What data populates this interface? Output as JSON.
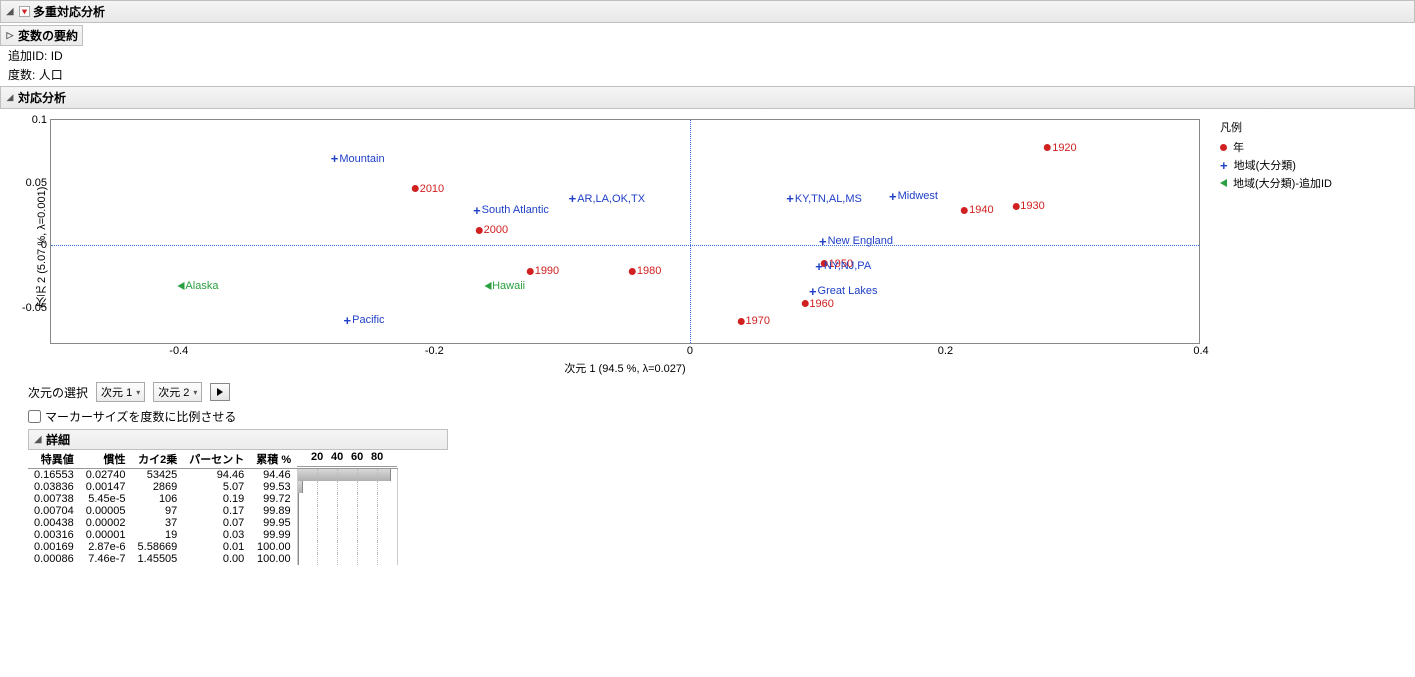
{
  "header": {
    "title": "多重対応分析"
  },
  "sub1": {
    "title": "変数の要約"
  },
  "info": {
    "id_label": "追加ID:",
    "id_value": "ID",
    "freq_label": "度数:",
    "freq_value": "人口"
  },
  "sub2": {
    "title": "対応分析"
  },
  "controls": {
    "dim_select_label": "次元の選択",
    "dim1": "次元 1",
    "dim2": "次元 2",
    "checkbox_label": "マーカーサイズを度数に比例させる"
  },
  "details_header": "詳細",
  "legend": {
    "title": "凡例",
    "item1": "年",
    "item2": "地域(大分類)",
    "item3": "地域(大分類)-追加ID"
  },
  "chart_data": {
    "type": "scatter",
    "xlabel": "次元 1  (94.5 %, λ=0.027)",
    "ylabel": "次元 2  (5.07 %, λ=0.001)",
    "xlim": [
      -0.5,
      0.4
    ],
    "ylim": [
      -0.08,
      0.1
    ],
    "xticks": [
      -0.4,
      -0.2,
      0,
      0.2,
      0.4
    ],
    "yticks": [
      -0.05,
      0,
      0.05,
      0.1
    ],
    "series": [
      {
        "name": "年",
        "marker": "dot",
        "color": "red",
        "points": [
          {
            "label": "2010",
            "x": -0.205,
            "y": 0.045
          },
          {
            "label": "2000",
            "x": -0.155,
            "y": 0.012
          },
          {
            "label": "1990",
            "x": -0.115,
            "y": -0.021
          },
          {
            "label": "1980",
            "x": -0.035,
            "y": -0.021
          },
          {
            "label": "1970",
            "x": 0.05,
            "y": -0.061
          },
          {
            "label": "1960",
            "x": 0.1,
            "y": -0.047
          },
          {
            "label": "1950",
            "x": 0.115,
            "y": -0.015
          },
          {
            "label": "1940",
            "x": 0.225,
            "y": 0.028
          },
          {
            "label": "1930",
            "x": 0.265,
            "y": 0.031
          },
          {
            "label": "1920",
            "x": 0.29,
            "y": 0.078
          }
        ]
      },
      {
        "name": "地域(大分類)",
        "marker": "plus",
        "color": "blue",
        "points": [
          {
            "label": "Mountain",
            "x": -0.26,
            "y": 0.069
          },
          {
            "label": "Pacific",
            "x": -0.255,
            "y": -0.06
          },
          {
            "label": "South Atlantic",
            "x": -0.14,
            "y": 0.028
          },
          {
            "label": "AR,LA,OK,TX",
            "x": -0.065,
            "y": 0.037
          },
          {
            "label": "KY,TN,AL,MS",
            "x": 0.105,
            "y": 0.037
          },
          {
            "label": "Midwest",
            "x": 0.175,
            "y": 0.039
          },
          {
            "label": "New England",
            "x": 0.13,
            "y": 0.003
          },
          {
            "label": "NY,NJ,PA",
            "x": 0.12,
            "y": -0.017
          },
          {
            "label": "Great Lakes",
            "x": 0.12,
            "y": -0.037
          }
        ]
      },
      {
        "name": "地域(大分類)-追加ID",
        "marker": "tri",
        "color": "green",
        "points": [
          {
            "label": "Alaska",
            "x": -0.385,
            "y": -0.033
          },
          {
            "label": "Hawaii",
            "x": -0.145,
            "y": -0.033
          }
        ]
      }
    ]
  },
  "details_table": {
    "headers": [
      "特異値",
      "慣性",
      "カイ2乗",
      "パーセント",
      "累積 %"
    ],
    "bar_ticks": [
      20,
      40,
      60,
      80
    ],
    "rows": [
      {
        "vals": [
          "0.16553",
          "0.02740",
          "53425",
          "94.46",
          "94.46"
        ],
        "pct": 94.46
      },
      {
        "vals": [
          "0.03836",
          "0.00147",
          "2869",
          "5.07",
          "99.53"
        ],
        "pct": 5.07
      },
      {
        "vals": [
          "0.00738",
          "5.45e-5",
          "106",
          "0.19",
          "99.72"
        ],
        "pct": 0.19
      },
      {
        "vals": [
          "0.00704",
          "0.00005",
          "97",
          "0.17",
          "99.89"
        ],
        "pct": 0.17
      },
      {
        "vals": [
          "0.00438",
          "0.00002",
          "37",
          "0.07",
          "99.95"
        ],
        "pct": 0.07
      },
      {
        "vals": [
          "0.00316",
          "0.00001",
          "19",
          "0.03",
          "99.99"
        ],
        "pct": 0.03
      },
      {
        "vals": [
          "0.00169",
          "2.87e-6",
          "5.58669",
          "0.01",
          "100.00"
        ],
        "pct": 0.01
      },
      {
        "vals": [
          "0.00086",
          "7.46e-7",
          "1.45505",
          "0.00",
          "100.00"
        ],
        "pct": 0.0
      }
    ]
  }
}
